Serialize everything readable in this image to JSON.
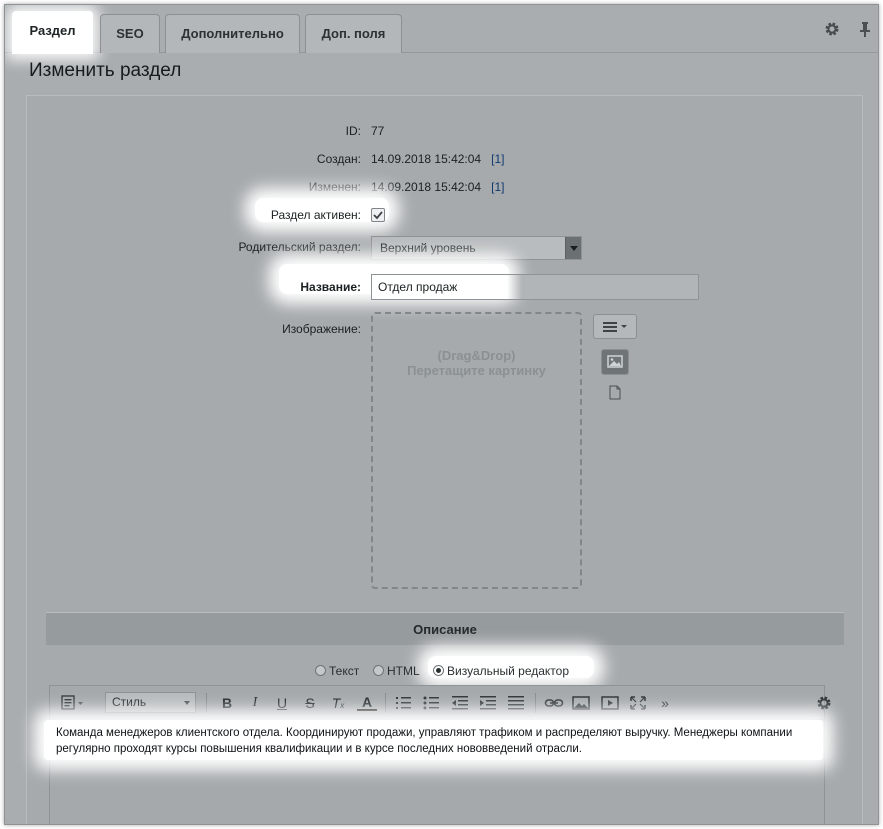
{
  "tabs": [
    {
      "label": "Раздел",
      "active": true
    },
    {
      "label": "SEO",
      "active": false
    },
    {
      "label": "Дополнительно",
      "active": false
    },
    {
      "label": "Доп. поля",
      "active": false
    }
  ],
  "tabbar_icons": [
    "gear-icon",
    "pin-icon"
  ],
  "page_title": "Изменить раздел",
  "fields": {
    "id": {
      "label": "ID:",
      "value": "77"
    },
    "created": {
      "label": "Создан:",
      "value": "14.09.2018 15:42:04",
      "link": "[1]"
    },
    "modified": {
      "label": "Изменен:",
      "value": "14.09.2018 15:42:04",
      "link": "[1]"
    },
    "active": {
      "label": "Раздел активен:",
      "checked": true
    },
    "parent": {
      "label": "Родительский раздел:",
      "value": "Верхний уровень"
    },
    "name": {
      "label": "Название:",
      "value": "Отдел продаж"
    },
    "image": {
      "label": "Изображение:",
      "drop_line1": "(Drag&Drop)",
      "drop_line2": "Перетащите картинку"
    }
  },
  "description": {
    "section_title": "Описание",
    "modes": [
      {
        "label": "Текст",
        "selected": false
      },
      {
        "label": "HTML",
        "selected": false
      },
      {
        "label": "Визуальный редактор",
        "selected": true
      }
    ],
    "style_select": "Стиль",
    "content": "Команда менеджеров клиентского отдела. Координируют продажи, управляют трафиком и распределяют выручку. Менеджеры компании регулярно проходят курсы повышения квалификации и в курсе последних нововведений отрасли."
  },
  "colors": {
    "highlight": "#ffffff",
    "dim_background": "#a9adaf",
    "link": "#103a70"
  }
}
